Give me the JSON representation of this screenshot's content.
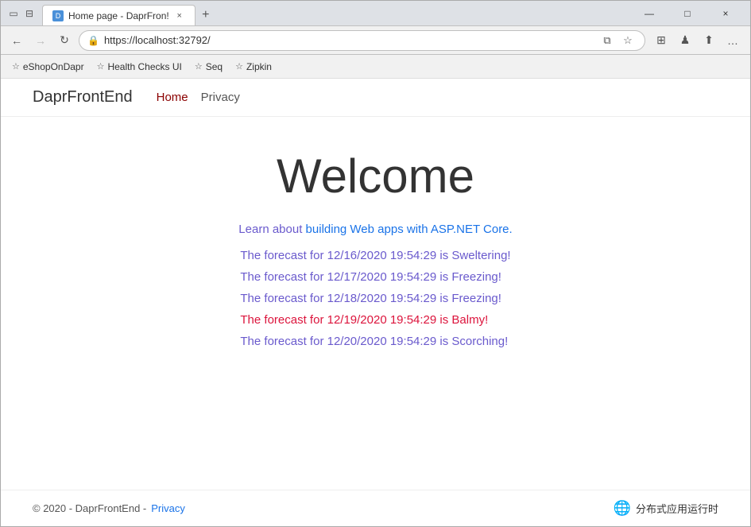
{
  "browser": {
    "title": "Home page - DaprFron!",
    "url": "https://localhost:32792/",
    "tab_label": "Home page - DaprFron!",
    "new_tab_symbol": "+",
    "back_disabled": false,
    "forward_disabled": true
  },
  "bookmarks": [
    {
      "id": "eshopondapr",
      "label": "eShopOnDapr"
    },
    {
      "id": "health-checks-ui",
      "label": "Health Checks UI"
    },
    {
      "id": "seq",
      "label": "Seq"
    },
    {
      "id": "zipkin",
      "label": "Zipkin"
    }
  ],
  "site": {
    "brand": "DaprFrontEnd",
    "nav": [
      {
        "id": "home",
        "label": "Home",
        "active": true
      },
      {
        "id": "privacy",
        "label": "Privacy",
        "active": false
      }
    ]
  },
  "main": {
    "welcome_title": "Welcome",
    "subtitle": "Learn about ",
    "subtitle_link_text": "building Web apps with ASP.NET Core.",
    "forecasts": [
      {
        "text": "The forecast for 12/16/2020 19:54:29 is Sweltering!"
      },
      {
        "text": "The forecast for 12/17/2020 19:54:29 is Freezing!"
      },
      {
        "text": "The forecast for 12/18/2020 19:54:29 is Freezing!"
      },
      {
        "text": "The forecast for 12/19/2020 19:54:29 is Balmy!"
      },
      {
        "text": "The forecast for 12/20/2020 19:54:29 is Scorching!"
      }
    ]
  },
  "footer": {
    "copyright": "© 2020 - DaprFrontEnd -",
    "privacy_link": "Privacy",
    "right_text": "分布式应用运行时"
  },
  "icons": {
    "back": "←",
    "forward": "→",
    "reload": "↻",
    "lock": "🔒",
    "star": "☆",
    "tab_icon": "D",
    "tab_close": "×",
    "minimize": "—",
    "maximize": "□",
    "close": "×",
    "collections": "⊞",
    "profile": "♟",
    "share": "⬆",
    "more": "…",
    "apps": "⊞",
    "window_icon": "▭"
  },
  "forecast_colors": {
    "color1": "#6a5acd",
    "color2": "#6a5acd",
    "color3": "#6a5acd",
    "color4": "#dc143c",
    "color5": "#6a5acd"
  }
}
